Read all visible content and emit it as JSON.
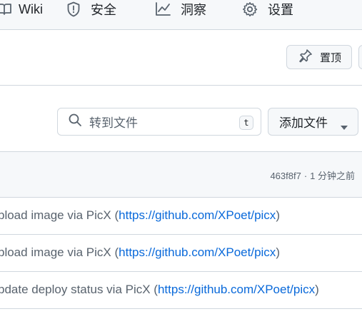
{
  "nav": {
    "items": [
      {
        "label": "Wiki",
        "icon": "book-icon"
      },
      {
        "label": "安全",
        "icon": "shield-icon"
      },
      {
        "label": "洞察",
        "icon": "graph-icon"
      },
      {
        "label": "设置",
        "icon": "gear-icon"
      }
    ]
  },
  "repo_actions": {
    "pin_label": "置顶"
  },
  "file_nav": {
    "search_placeholder": "转到文件",
    "search_shortcut": "t",
    "add_file_label": "添加文件"
  },
  "latest_commit": {
    "hash": "463f8f7",
    "separator": "·",
    "time": "1 分钟之前"
  },
  "rows": [
    {
      "message_prefix": "pload image via PicX (",
      "link": "https://github.com/XPoet/picx",
      "message_suffix": ")"
    },
    {
      "message_prefix": "pload image via PicX (",
      "link": "https://github.com/XPoet/picx",
      "message_suffix": ")"
    },
    {
      "message_prefix": "pdate deploy status via PicX (",
      "link": "https://github.com/XPoet/picx",
      "message_suffix": ")"
    }
  ],
  "colors": {
    "link": "#0969da",
    "muted": "#59636e",
    "border": "#d0d7de",
    "subtle_bg": "#f6f8fa"
  }
}
